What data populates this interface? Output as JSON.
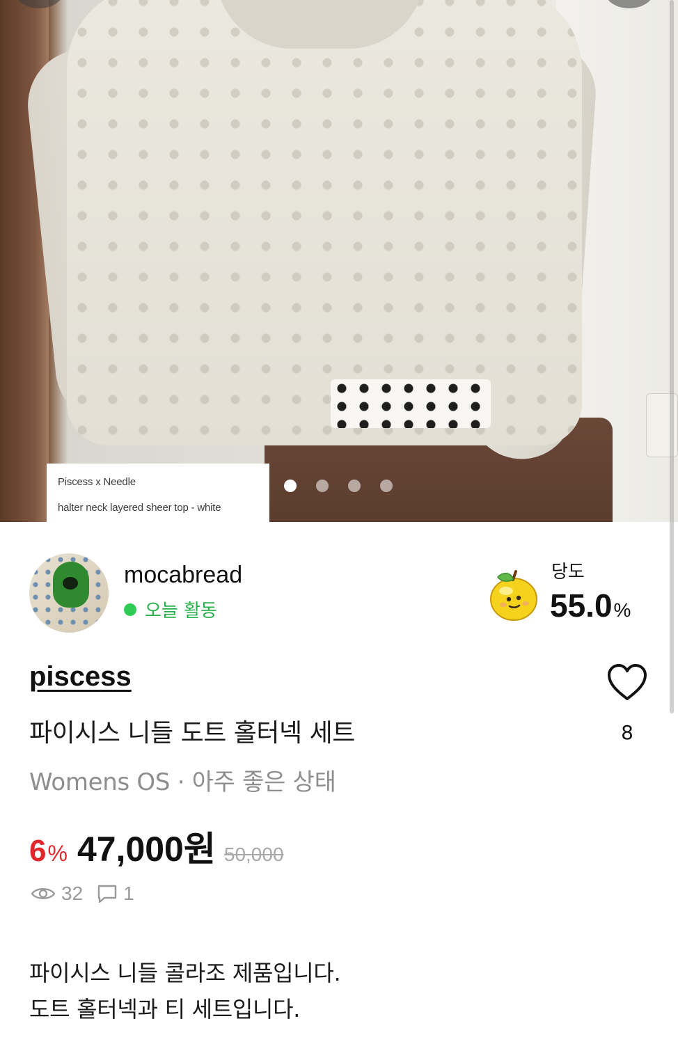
{
  "photo": {
    "caption_line1": "Piscess x Needle",
    "caption_line2": "halter neck layered sheer top - white",
    "pager_count": 4,
    "pager_active": 1
  },
  "seller": {
    "name": "mocabread",
    "activity": "오늘 활동",
    "sweetness_label": "당도",
    "sweetness_value": "55.0",
    "sweetness_unit": "%"
  },
  "product": {
    "brand": "piscess",
    "title": "파이시스 니들 도트 홀터넥 세트",
    "meta": "Womens OS · 아주 좋은 상태",
    "likes": "8",
    "discount_value": "6",
    "discount_unit": "%",
    "price": "47,000원",
    "original_price": "50,000",
    "views": "32",
    "comments": "1",
    "description_line1": "파이시스 니들 콜라조 제품입니다.",
    "description_line2": "도트 홀터넥과 티 세트입니다."
  },
  "colors": {
    "discount": "#e3262b",
    "online": "#2ecc55",
    "muted": "#8e8e8e"
  },
  "icons": [
    "heart-icon",
    "eye-icon",
    "comment-icon",
    "apple-icon"
  ]
}
